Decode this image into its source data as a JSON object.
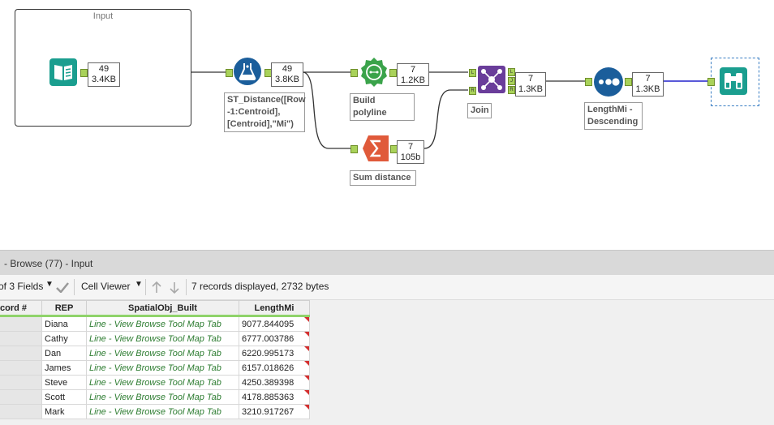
{
  "canvas": {
    "container_title": "Input",
    "input_meta": {
      "records": "49",
      "size": "3.4KB"
    },
    "formula": {
      "label": "ST_Distance([Row\n-1:Centroid],\n[Centroid],\"Mi\")",
      "meta_records": "49",
      "meta_size": "3.8KB"
    },
    "polybuild": {
      "label": "Build polyline",
      "meta_records": "7",
      "meta_size": "1.2KB"
    },
    "summarize": {
      "label": "Sum distance",
      "meta_records": "7",
      "meta_size": "105b"
    },
    "join": {
      "label": "Join",
      "meta_records": "7",
      "meta_size": "1.3KB",
      "anchors": [
        "L",
        "J",
        "R"
      ],
      "in_anchors": [
        "L",
        "R"
      ]
    },
    "sort": {
      "label": "LengthMi -\nDescending",
      "meta_records": "7",
      "meta_size": "1.3KB"
    },
    "colors": {
      "tool_blue": "#1b5e9b",
      "tool_green": "#3aa34a",
      "tool_orange": "#e05a3a",
      "tool_purple": "#6a3d9a",
      "tool_teal": "#1a9e8f",
      "wire": "#333333",
      "wire_selected": "#2222cc"
    }
  },
  "results": {
    "title": "- Browse (77) - Input",
    "fields_selector": "of 3 Fields",
    "viewer": "Cell Viewer",
    "status": "7 records displayed, 2732 bytes",
    "columns": [
      "cord #",
      "REP",
      "SpatialObj_Built",
      "LengthMi"
    ],
    "rows": [
      {
        "rep": "Diana",
        "spatial": "Line - View Browse Tool Map Tab",
        "length": "9077.844095"
      },
      {
        "rep": "Cathy",
        "spatial": "Line - View Browse Tool Map Tab",
        "length": "6777.003786"
      },
      {
        "rep": "Dan",
        "spatial": "Line - View Browse Tool Map Tab",
        "length": "6220.995173"
      },
      {
        "rep": "James",
        "spatial": "Line - View Browse Tool Map Tab",
        "length": "6157.018626"
      },
      {
        "rep": "Steve",
        "spatial": "Line - View Browse Tool Map Tab",
        "length": "4250.389398"
      },
      {
        "rep": "Scott",
        "spatial": "Line - View Browse Tool Map Tab",
        "length": "4178.885363"
      },
      {
        "rep": "Mark",
        "spatial": "Line - View Browse Tool Map Tab",
        "length": "3210.917267"
      }
    ]
  },
  "icons": {
    "input": "book-icon",
    "formula": "formula-flask-icon",
    "polybuild": "poly-build-icon",
    "summarize": "sigma-icon",
    "join": "join-icon",
    "sort": "sort-dots-icon",
    "browse": "binoculars-icon"
  }
}
